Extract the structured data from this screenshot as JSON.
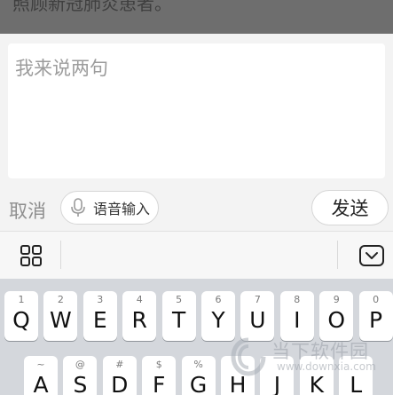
{
  "background": {
    "partial_text": "照顾新冠肺炎患者。"
  },
  "composer": {
    "placeholder": "我来说两句",
    "cancel_label": "取消",
    "voice_label": "语音输入",
    "send_label": "发送"
  },
  "toolbar": {
    "left_icon": "grid-apps-icon",
    "right_icon": "keyboard-collapse-icon"
  },
  "keyboard": {
    "row1": [
      {
        "main": "Q",
        "sub": "1"
      },
      {
        "main": "W",
        "sub": "2"
      },
      {
        "main": "E",
        "sub": "3"
      },
      {
        "main": "R",
        "sub": "4"
      },
      {
        "main": "T",
        "sub": "5"
      },
      {
        "main": "Y",
        "sub": "6"
      },
      {
        "main": "U",
        "sub": "7"
      },
      {
        "main": "I",
        "sub": "8"
      },
      {
        "main": "O",
        "sub": "9"
      },
      {
        "main": "P",
        "sub": "0"
      }
    ],
    "row2": [
      {
        "main": "A",
        "sub": "~"
      },
      {
        "main": "S",
        "sub": "@"
      },
      {
        "main": "D",
        "sub": "#"
      },
      {
        "main": "F",
        "sub": "$"
      },
      {
        "main": "G",
        "sub": "%"
      },
      {
        "main": "H",
        "sub": ""
      },
      {
        "main": "J",
        "sub": ""
      },
      {
        "main": "K",
        "sub": ""
      },
      {
        "main": "L",
        "sub": ""
      }
    ]
  },
  "watermark": {
    "brand": "当下软件园",
    "url": "www.downxia.com"
  },
  "colors": {
    "overlay": "#6e6e6e",
    "panel": "#f3f3f3",
    "keyboard": "#d4d7dc",
    "key": "#ffffff"
  }
}
